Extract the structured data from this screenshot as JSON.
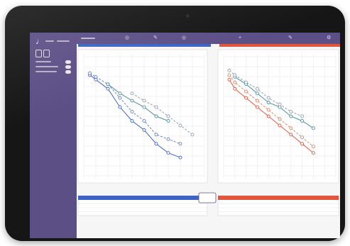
{
  "app": {
    "brand_icon": "ear-logo-icon",
    "header_icons": [
      "left-ear-header-icon",
      "right-ear-header-icon",
      "add-icon",
      "settings-icon"
    ]
  },
  "colors": {
    "left_ear": "#3e63c6",
    "right_ear": "#e2553d",
    "sidebar": "#5c4f86"
  },
  "left_audiogram": {
    "series": [
      {
        "points": [
          [
            0.5,
            10
          ],
          [
            1,
            15
          ],
          [
            2,
            25
          ],
          [
            3,
            45
          ],
          [
            4,
            60
          ],
          [
            5,
            70
          ],
          [
            6,
            85
          ],
          [
            7,
            95
          ],
          [
            8,
            100
          ]
        ],
        "color": "#3e63c6"
      },
      {
        "points": [
          [
            0.5,
            8
          ],
          [
            1,
            12
          ],
          [
            2,
            20
          ],
          [
            3,
            35
          ],
          [
            4,
            50
          ],
          [
            5,
            60
          ],
          [
            6,
            75
          ],
          [
            7,
            80
          ],
          [
            8,
            85
          ]
        ],
        "color": "#6a7fbf"
      },
      {
        "points": [
          [
            2,
            20
          ],
          [
            3,
            30
          ],
          [
            4,
            38
          ],
          [
            5,
            45
          ],
          [
            6,
            55
          ],
          [
            7,
            60
          ]
        ],
        "color": "#4a8f9f"
      },
      {
        "points": [
          [
            4,
            30
          ],
          [
            5,
            38
          ],
          [
            6,
            45
          ],
          [
            7,
            55
          ],
          [
            8,
            65
          ],
          [
            9,
            75
          ]
        ],
        "color": "#90a0b0"
      }
    ]
  },
  "right_audiogram": {
    "series": [
      {
        "points": [
          [
            0.5,
            15
          ],
          [
            1,
            25
          ],
          [
            2,
            35
          ],
          [
            3,
            45
          ],
          [
            4,
            55
          ],
          [
            5,
            65
          ],
          [
            6,
            75
          ],
          [
            7,
            85
          ],
          [
            8,
            95
          ]
        ],
        "color": "#e2553d"
      },
      {
        "points": [
          [
            0.5,
            10
          ],
          [
            1,
            18
          ],
          [
            2,
            28
          ],
          [
            3,
            38
          ],
          [
            4,
            48
          ],
          [
            5,
            58
          ],
          [
            6,
            68
          ],
          [
            7,
            78
          ],
          [
            8,
            88
          ]
        ],
        "color": "#d98a6a"
      },
      {
        "points": [
          [
            1,
            12
          ],
          [
            2,
            20
          ],
          [
            3,
            30
          ],
          [
            4,
            40
          ],
          [
            5,
            45
          ],
          [
            6,
            55
          ],
          [
            7,
            60
          ],
          [
            8,
            68
          ]
        ],
        "color": "#4a8f9f"
      },
      {
        "points": [
          [
            0.5,
            5
          ],
          [
            1,
            10
          ],
          [
            2,
            18
          ],
          [
            3,
            25
          ],
          [
            4,
            35
          ],
          [
            5,
            42
          ],
          [
            6,
            50
          ],
          [
            7,
            55
          ]
        ],
        "color": "#90a0b0"
      }
    ]
  }
}
